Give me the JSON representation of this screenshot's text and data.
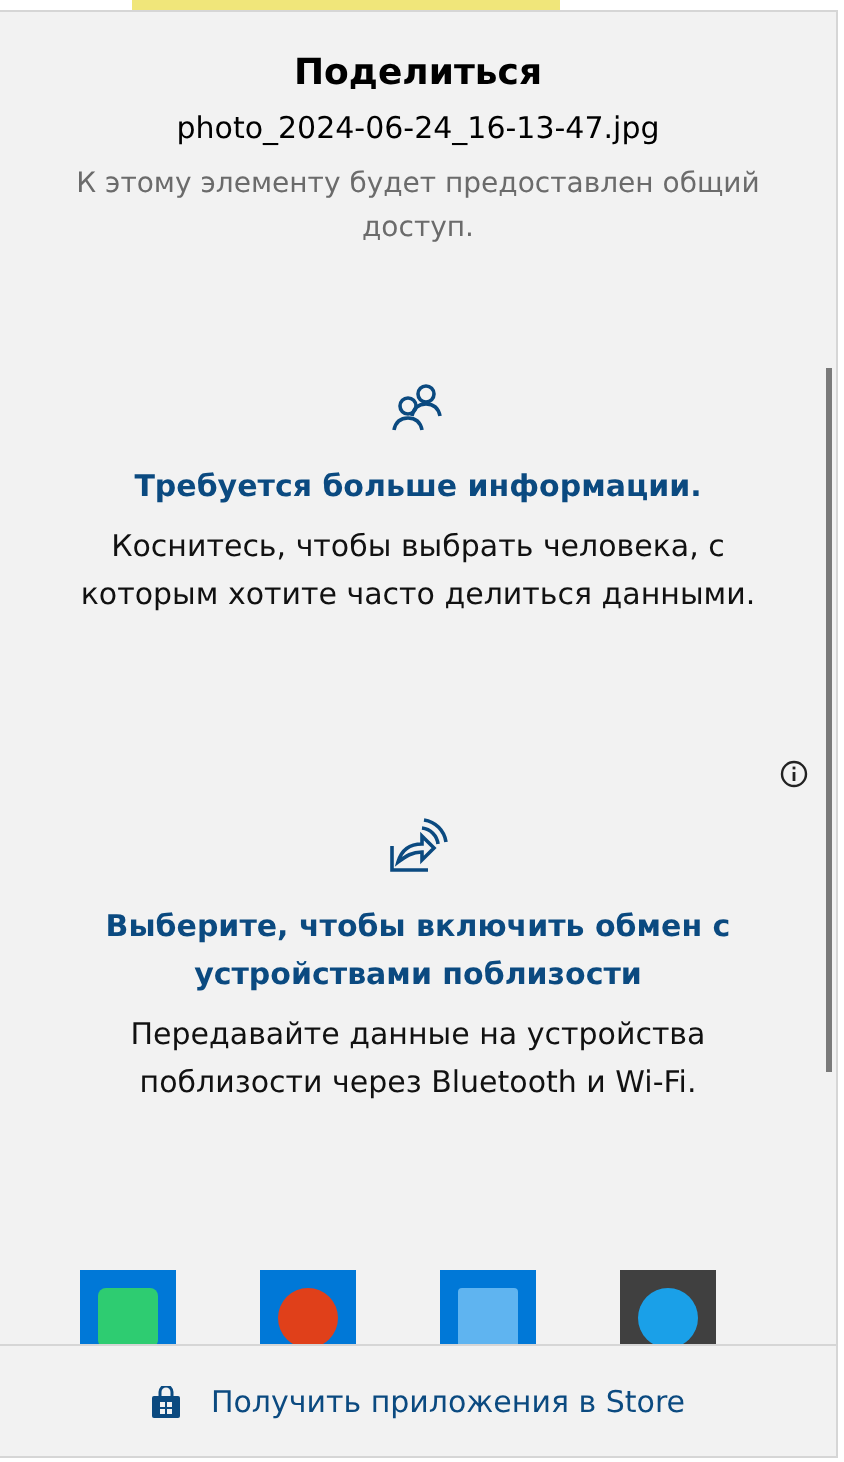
{
  "header": {
    "title": "Поделиться",
    "file_name": "photo_2024-06-24_16-13-47.jpg",
    "note": "К этому элементу будет предоставлен общий доступ."
  },
  "sections": [
    {
      "kind": "people",
      "heading": "Требуется больше информации.",
      "text": "Коснитесь, чтобы выбрать человека, с которым хотите часто делиться данными."
    },
    {
      "kind": "nearby",
      "heading": "Выберите, чтобы включить обмен с устройствами поблизости",
      "text": "Передавайте данные на устройства поблизости через Bluetooth и Wi-Fi."
    }
  ],
  "apps": [
    {
      "color": "#0078d7"
    },
    {
      "color": "#0078d7"
    },
    {
      "color": "#0078d7"
    },
    {
      "color": "#404040"
    }
  ],
  "store_link": "Получить приложения в Store"
}
